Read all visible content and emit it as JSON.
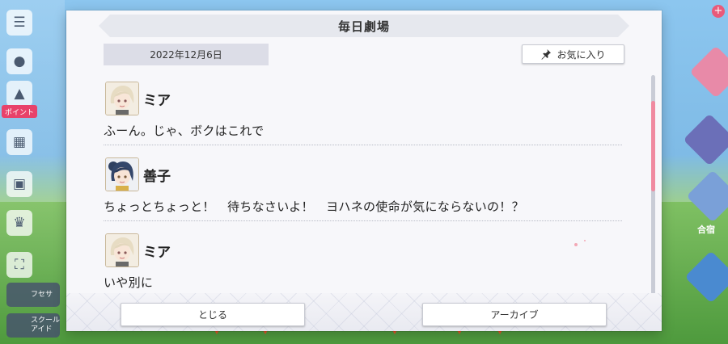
{
  "dialog": {
    "title": "毎日劇場",
    "date": "2022年12月6日",
    "favorite_label": "お気に入り",
    "close_label": "とじる",
    "archive_label": "アーカイブ"
  },
  "messages": [
    {
      "speaker": "ミア",
      "avatar": "mia",
      "text": "ふーん。じゃ、ボクはこれで"
    },
    {
      "speaker": "善子",
      "avatar": "yoshiko",
      "text": "ちょっとちょっと！　待ちなさいよ！　ヨハネの使命が気にならないの！？"
    },
    {
      "speaker": "ミア",
      "avatar": "mia",
      "text": "いや別に"
    }
  ],
  "background": {
    "event_badge": "ポイント",
    "rail_wide_1": "フセサ",
    "rail_wide_2": "スクール アイド",
    "kasshuku": "合宿"
  },
  "colors": {
    "scroll_thumb": "#f08aa0",
    "dialog_bg": "#f7f7fa",
    "title_bar": "#e6e8ee",
    "date_bg": "#dcdde7"
  },
  "scroll": {
    "position_fraction": 0.2,
    "visible_fraction": 0.41
  }
}
